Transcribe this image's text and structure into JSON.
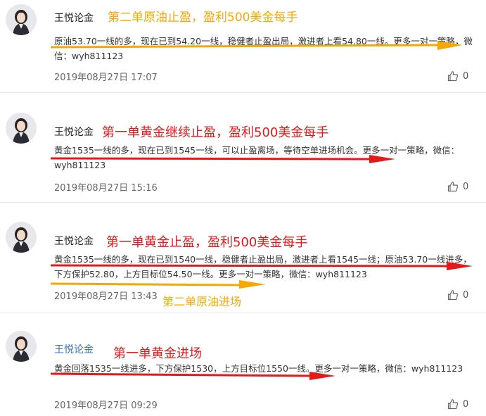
{
  "posts": [
    {
      "author": "王悦论金",
      "headline": "第二单原油止盈，盈利500美金每手",
      "body": "原油53.70一线的多，现在已到54.20一线，稳健者止盈出局，激进者上看54.80一线。更多一对一策略，微信：wyh811123",
      "timestamp": "2019年08月27日 17:07",
      "likes": "0"
    },
    {
      "author": "王悦论金",
      "headline": "第一单黄金继续止盈，盈利500美金每手",
      "body": "黄金1535一线的多，现在已到1545一线，可以止盈离场，等待空单进场机会。更多一对一策略，微信：wyh811123",
      "timestamp": "2019年08月27日 15:16",
      "likes": "0"
    },
    {
      "author": "王悦论金",
      "headline": "第一单黄金止盈，盈利500美金每手",
      "body": "黄金1535一线的多，现在已到1540一线，稳健者止盈出局，激进者上看1545一线；原油53.70一线进多，下方保护52.80，上方目标位54.50一线。更多一对一策略，微信：wyh811123",
      "timestamp": "2019年08月27日 13:43",
      "likes": "0",
      "note": "第二单原油进场"
    },
    {
      "author": "王悦论金",
      "headline": "第一单黄金进场",
      "body": "黄金回落1535一线进多，下方保护1530，上方目标位1550一线。更多一对一策略，微信：wyh811123",
      "timestamp": "2019年08月27日 09:29",
      "likes": "0"
    }
  ],
  "colors": {
    "orange_annotation": "#f6a800",
    "red_annotation": "#e81818",
    "author_highlight": "#3a6fc4",
    "divider": "#e6e6e6"
  },
  "icons": {
    "avatar": "profile-photo",
    "like": "thumbs-up-icon",
    "arrow": "annotation-arrow"
  }
}
